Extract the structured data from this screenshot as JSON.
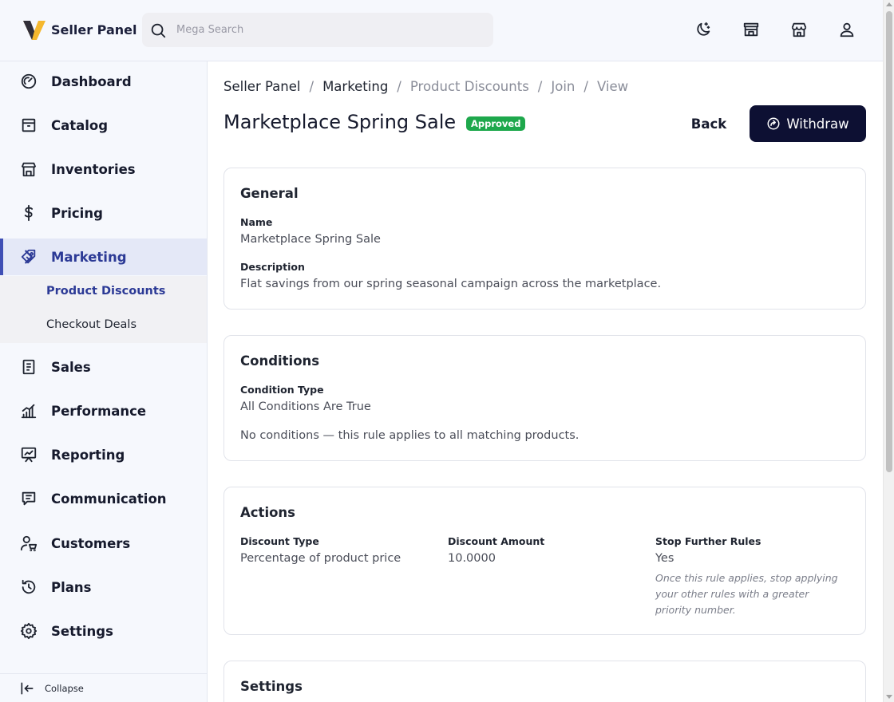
{
  "app": {
    "logo_text": "Seller Panel"
  },
  "search": {
    "placeholder": "Mega Search"
  },
  "header_icons": [
    "moon-icon",
    "store-icon",
    "storefront-icon",
    "user-icon"
  ],
  "sidebar": {
    "items": [
      {
        "label": "Dashboard",
        "icon": "gauge-icon"
      },
      {
        "label": "Catalog",
        "icon": "box-icon"
      },
      {
        "label": "Inventories",
        "icon": "warehouse-icon"
      },
      {
        "label": "Pricing",
        "icon": "dollar-icon"
      },
      {
        "label": "Marketing",
        "icon": "ticket-icon"
      },
      {
        "label": "Sales",
        "icon": "document-icon"
      },
      {
        "label": "Performance",
        "icon": "bar-chart-icon"
      },
      {
        "label": "Reporting",
        "icon": "presentation-icon"
      },
      {
        "label": "Communication",
        "icon": "chat-icon"
      },
      {
        "label": "Customers",
        "icon": "customers-icon"
      },
      {
        "label": "Plans",
        "icon": "history-icon"
      },
      {
        "label": "Settings",
        "icon": "gear-icon"
      }
    ],
    "active": "Marketing",
    "sub_items": [
      {
        "label": "Product Discounts"
      },
      {
        "label": "Checkout Deals"
      }
    ],
    "collapse_label": "Collapse"
  },
  "breadcrumb": [
    "Seller Panel",
    "Marketing",
    "Product Discounts",
    "Join",
    "View"
  ],
  "page": {
    "title": "Marketplace Spring Sale",
    "status": "Approved",
    "back_label": "Back",
    "withdraw_label": "Withdraw"
  },
  "general": {
    "title": "General",
    "name_label": "Name",
    "name_value": "Marketplace Spring Sale",
    "description_label": "Description",
    "description_value": "Flat savings from our spring seasonal campaign across the marketplace."
  },
  "conditions": {
    "title": "Conditions",
    "type_label": "Condition Type",
    "type_value": "All Conditions Are True",
    "note": "No conditions — this rule applies to all matching products."
  },
  "actions": {
    "title": "Actions",
    "discount_type_label": "Discount Type",
    "discount_type_value": "Percentage of product price",
    "discount_amount_label": "Discount Amount",
    "discount_amount_value": "10.0000",
    "stop_label": "Stop Further Rules",
    "stop_value": "Yes",
    "stop_note": "Once this rule applies, stop applying your other rules with a greater priority number."
  },
  "settings": {
    "title": "Settings"
  },
  "colors": {
    "accent": "#2c3a96",
    "primary_button": "#0d1033",
    "badge_green": "#1ea84c",
    "logo_yellow": "#f5b82e"
  }
}
